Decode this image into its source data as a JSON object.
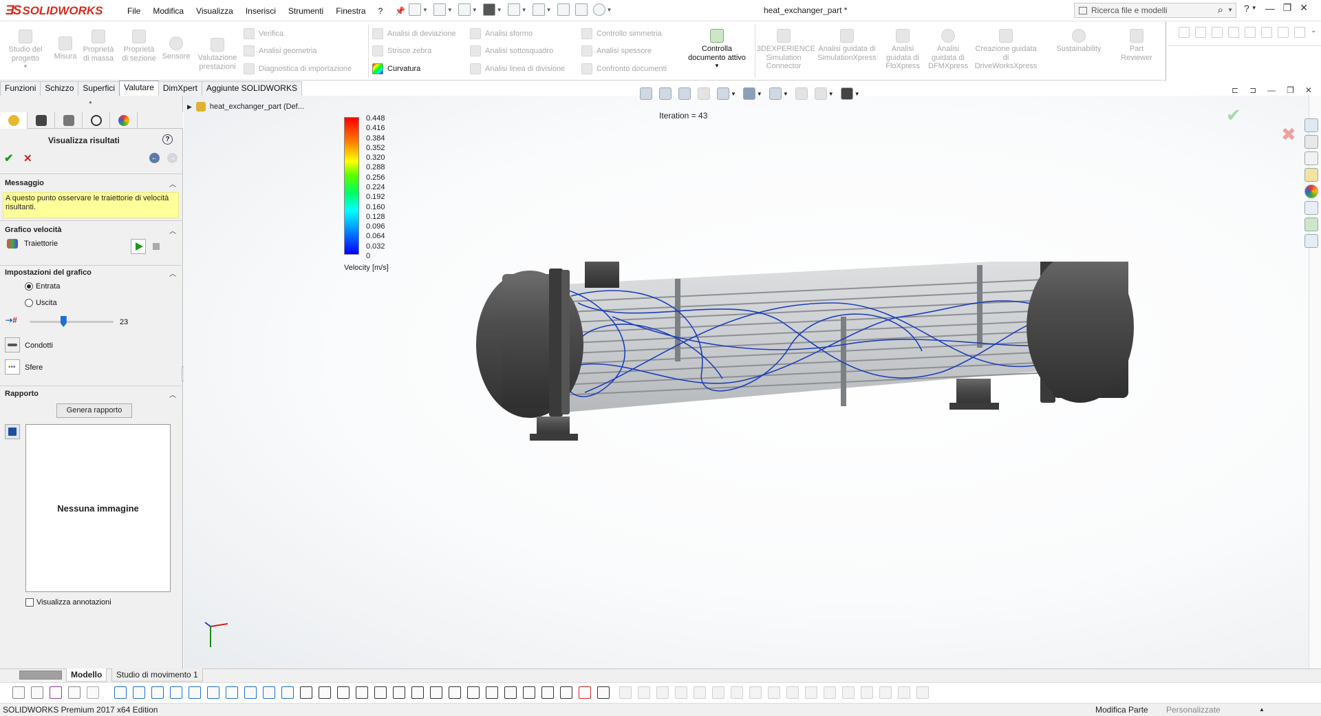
{
  "app": {
    "name": "SOLIDWORKS",
    "document_title": "heat_exchanger_part *"
  },
  "menu": [
    "File",
    "Modifica",
    "Visualizza",
    "Inserisci",
    "Strumenti",
    "Finestra",
    "?"
  ],
  "search": {
    "placeholder": "Ricerca file e modelli"
  },
  "command_manager": {
    "big_buttons_left": [
      "Studio del progetto",
      "Misura",
      "Proprietà di massa",
      "Proprietà di sezione",
      "Sensore",
      "Valutazione prestazioni"
    ],
    "col1": [
      "Verifica",
      "Analisi geometria",
      "Diagnostica di importazione"
    ],
    "col2": [
      "Analisi di deviazione",
      "Strisce zebra",
      "Curvatura"
    ],
    "col3": [
      "Analisi sformo",
      "Analisi sottosquadro",
      "Analisi linea di divisione"
    ],
    "col4": [
      "Controllo simmetria",
      "Analisi spessore",
      "Confronto documenti"
    ],
    "active_doc": "Controlla documento attivo",
    "big_buttons_right": [
      "3DEXPERIENCE Simulation Connector",
      "Analisi guidata di SimulationXpress",
      "Analisi guidata di FloXpress",
      "Analisi guidata di DFMXpress",
      "Creazione guidata di DriveWorksXpress",
      "Sustainability",
      "Part Reviewer"
    ]
  },
  "tabs": [
    "Funzioni",
    "Schizzo",
    "Superfici",
    "Valutare",
    "DimXpert",
    "Aggiunte SOLIDWORKS"
  ],
  "panel": {
    "title": "Visualizza risultati",
    "msg_header": "Messaggio",
    "message": "A questo punto osservare le traiettorie di velocità risultanti.",
    "velocity_header": "Grafico velocità",
    "trajectories": "Traiettorie",
    "settings_header": "Impostazioni del grafico",
    "inlet": "Entrata",
    "outlet": "Uscita",
    "slider_value": "23",
    "slider_fraction": 0.4,
    "pipes": "Condotti",
    "spheres": "Sfere",
    "report_header": "Rapporto",
    "gen_report": "Genera rapporto",
    "no_image": "Nessuna immagine",
    "show_notes": "Visualizza annotazioni"
  },
  "tree": {
    "root": "heat_exchanger_part  (Def..."
  },
  "viewport": {
    "iteration": "Iteration = 43",
    "legend_ticks": [
      "0.448",
      "0.416",
      "0.384",
      "0.352",
      "0.320",
      "0.288",
      "0.256",
      "0.224",
      "0.192",
      "0.160",
      "0.128",
      "0.096",
      "0.064",
      "0.032",
      "0"
    ],
    "legend_unit": "Velocity [m/s]"
  },
  "bottom_tabs": [
    "Modello",
    "Studio di movimento 1"
  ],
  "status": {
    "left": "SOLIDWORKS Premium 2017 x64 Edition",
    "mid": "Modifica Parte",
    "right": "Personalizzate"
  }
}
